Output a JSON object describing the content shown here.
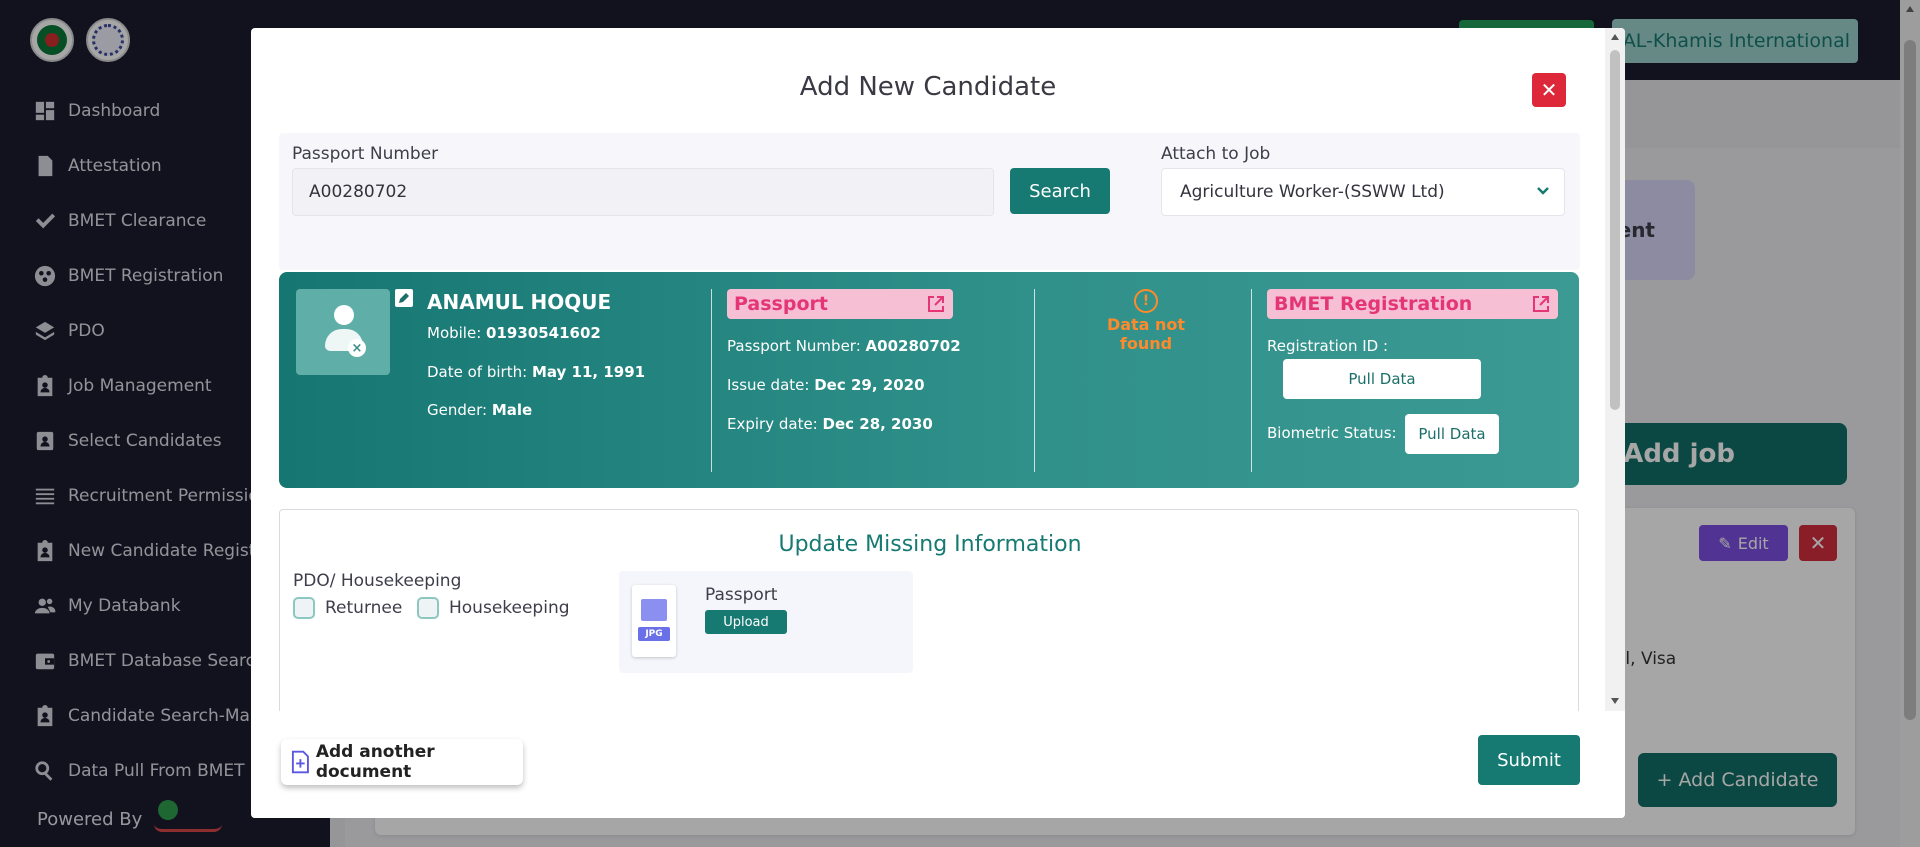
{
  "sidebar": {
    "logos": [
      "govt-seal",
      "ministry-seal"
    ],
    "items": [
      {
        "label": "Dashboard",
        "icon": "dashboard-icon"
      },
      {
        "label": "Attestation",
        "icon": "document-icon"
      },
      {
        "label": "BMET Clearance",
        "icon": "check-icon"
      },
      {
        "label": "BMET Registration",
        "icon": "registration-icon"
      },
      {
        "label": "PDO",
        "icon": "layers-icon"
      },
      {
        "label": "Job Management",
        "icon": "clipboard-user-icon"
      },
      {
        "label": "Select Candidates",
        "icon": "id-card-icon"
      },
      {
        "label": "Recruitment Permission",
        "icon": "list-icon"
      },
      {
        "label": "New Candidate Registration",
        "icon": "clipboard-user-icon"
      },
      {
        "label": "My Databank",
        "icon": "people-icon"
      },
      {
        "label": "BMET Database Search",
        "icon": "wallet-icon"
      },
      {
        "label": "Candidate Search-Manual",
        "icon": "clipboard-user-icon"
      },
      {
        "label": "Data Pull From BMET",
        "icon": "search-icon"
      }
    ],
    "powered_by": "Powered By"
  },
  "background": {
    "company_name": "AL-Khamis International",
    "card_partial_text": "ent",
    "add_job_label": "Add job",
    "edit_label": "Edit",
    "visa_text": "al, Visa",
    "add_candidate_label": "+ Add Candidate"
  },
  "modal": {
    "title": "Add New Candidate",
    "passport_label": "Passport Number",
    "passport_value": "A00280702",
    "search_label": "Search",
    "job_label": "Attach to Job",
    "job_value": "Agriculture Worker-(SSWW Ltd)",
    "candidate": {
      "name": "ANAMUL HOQUE",
      "mobile_label": "Mobile:",
      "mobile": "01930541602",
      "dob_label": "Date of birth:",
      "dob": "May 11, 1991",
      "gender_label": "Gender:",
      "gender": "Male"
    },
    "passport_section": {
      "title": "Passport",
      "number_label": "Passport Number:",
      "number": "A00280702",
      "issue_label": "Issue date:",
      "issue": "Dec 29, 2020",
      "expiry_label": "Expiry date:",
      "expiry": "Dec 28, 2030"
    },
    "not_found": "Data not found",
    "bmet": {
      "title": "BMET Registration",
      "reg_id_label": "Registration ID :",
      "pull_label": "Pull Data",
      "biometric_label": "Biometric Status:",
      "biometric_pull_label": "Pull Data"
    },
    "update": {
      "title": "Update Missing Information",
      "group_label": "PDO/ Housekeeping",
      "options": [
        "Returnee",
        "Housekeeping"
      ],
      "doc_name": "Passport",
      "doc_type": "JPG",
      "upload_label": "Upload"
    },
    "add_document_label": "Add another document",
    "submit_label": "Submit"
  },
  "colors": {
    "primary": "#167a72",
    "sidebar_bg": "#1c1d2f",
    "danger": "#dc2838",
    "pill_bg": "#f7bfd3",
    "pill_text": "#e43675",
    "warning": "#ff8a2a"
  }
}
